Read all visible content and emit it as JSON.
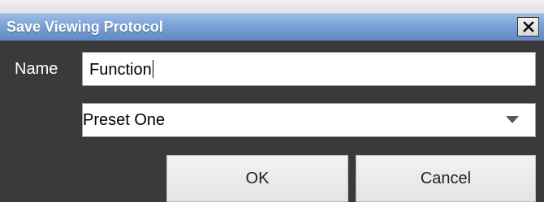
{
  "dialog": {
    "title": "Save Viewing Protocol",
    "close_label": "X"
  },
  "form": {
    "name_label": "Name",
    "name_value": "Function",
    "protocol_selected": "Preset One"
  },
  "buttons": {
    "ok": "OK",
    "cancel": "Cancel"
  },
  "colors": {
    "titlebar": "#7aa2d6",
    "body_background": "#3a3a3a"
  }
}
